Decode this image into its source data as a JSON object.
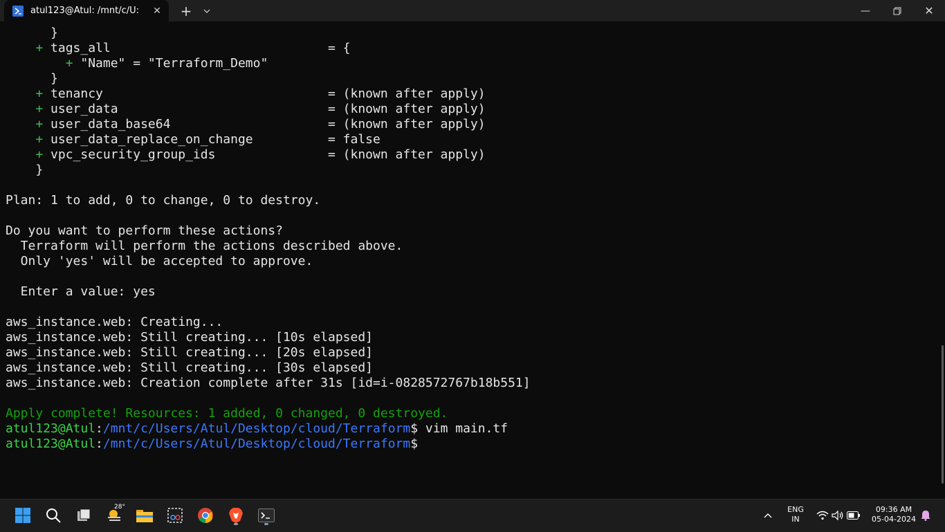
{
  "window": {
    "tab_title": "atul123@Atul: /mnt/c/U:",
    "new_tab_label": "+",
    "dropdown_label": "⌄",
    "minimize_label": "—",
    "close_label": "✕"
  },
  "terminal": {
    "l1": "      }",
    "l2": {
      "plus": "    + ",
      "text": "tags_all                             = {"
    },
    "l3": {
      "plus": "        + ",
      "text": "\"Name\" = \"Terraform_Demo\""
    },
    "l4": "      }",
    "l5": {
      "plus": "    + ",
      "text": "tenancy                              = (known after apply)"
    },
    "l6": {
      "plus": "    + ",
      "text": "user_data                            = (known after apply)"
    },
    "l7": {
      "plus": "    + ",
      "text": "user_data_base64                     = (known after apply)"
    },
    "l8": {
      "plus": "    + ",
      "text": "user_data_replace_on_change          = false"
    },
    "l9": {
      "plus": "    + ",
      "text": "vpc_security_group_ids               = (known after apply)"
    },
    "l10": "    }",
    "l11": "",
    "l12": "Plan: 1 to add, 0 to change, 0 to destroy.",
    "l13": "",
    "l14": "Do you want to perform these actions?",
    "l15": "  Terraform will perform the actions described above.",
    "l16": "  Only 'yes' will be accepted to approve.",
    "l17": "",
    "l18": "  Enter a value: yes",
    "l19": "",
    "l20": "aws_instance.web: Creating...",
    "l21": "aws_instance.web: Still creating... [10s elapsed]",
    "l22": "aws_instance.web: Still creating... [20s elapsed]",
    "l23": "aws_instance.web: Still creating... [30s elapsed]",
    "l24": "aws_instance.web: Creation complete after 31s [id=i-0828572767b18b551]",
    "l25": "",
    "l26": "Apply complete! Resources: 1 added, 0 changed, 0 destroyed.",
    "prompt1": {
      "user": "atul123@Atul",
      "sep": ":",
      "path": "/mnt/c/Users/Atul/Desktop/cloud/Terraform",
      "cmd": "$ vim main.tf"
    },
    "prompt2": {
      "user": "atul123@Atul",
      "sep": ":",
      "path": "/mnt/c/Users/Atul/Desktop/cloud/Terraform",
      "cmd": "$ "
    }
  },
  "taskbar": {
    "weather_temp": "28°",
    "lang_top": "ENG",
    "lang_bottom": "IN",
    "time": "09:36 AM",
    "date": "05-04-2024",
    "chevron": "^"
  },
  "colors": {
    "plus": "#3fb950",
    "prompt_user": "#3bd24a",
    "prompt_path": "#3b78ff",
    "apply": "#13a10e",
    "background": "#0c0c0c"
  }
}
